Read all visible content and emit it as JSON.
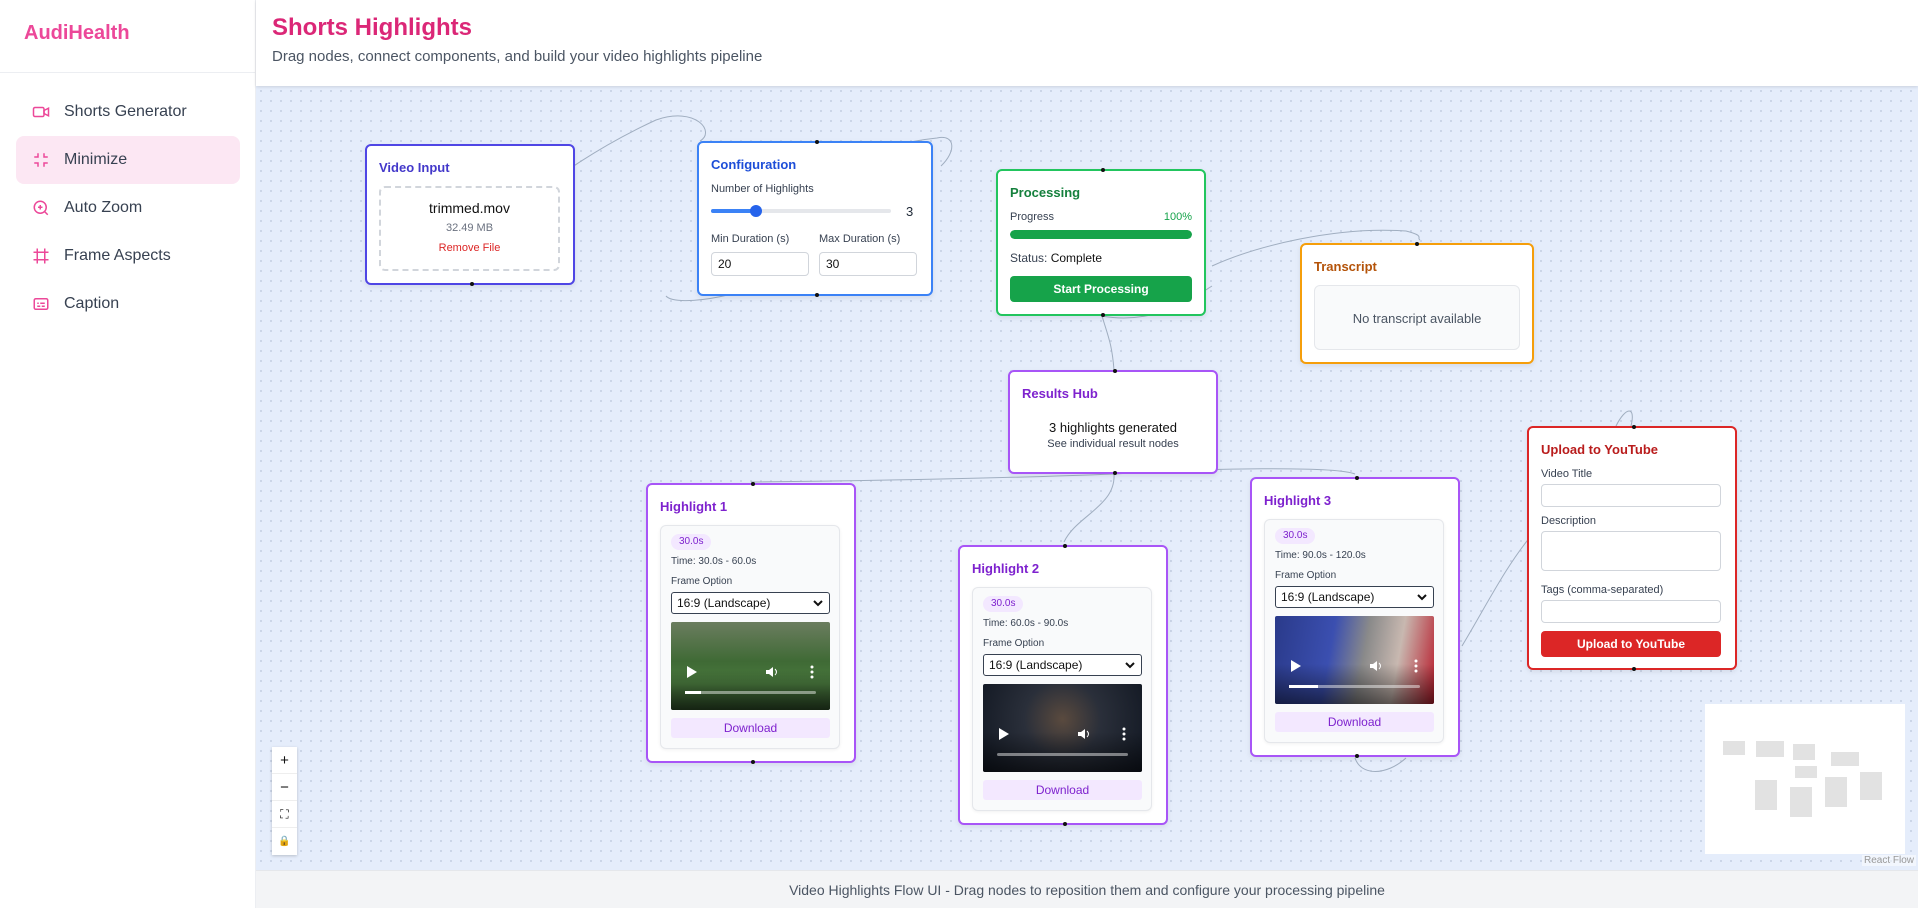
{
  "sidebar": {
    "brand": "AudiHealth",
    "items": [
      {
        "label": "Shorts Generator",
        "icon": "video-camera-icon"
      },
      {
        "label": "Minimize",
        "icon": "minimize-icon"
      },
      {
        "label": "Auto Zoom",
        "icon": "zoom-in-icon"
      },
      {
        "label": "Frame Aspects",
        "icon": "hash-frame-icon"
      },
      {
        "label": "Caption",
        "icon": "caption-icon"
      }
    ],
    "active": "Minimize"
  },
  "header": {
    "title": "Shorts Highlights",
    "subtitle": "Drag nodes, connect components, and build your video highlights pipeline"
  },
  "video_input": {
    "title": "Video Input",
    "file_name": "trimmed.mov",
    "file_size": "32.49 MB",
    "remove_label": "Remove File"
  },
  "configuration": {
    "title": "Configuration",
    "highlights_label": "Number of Highlights",
    "highlights_value": "3",
    "slider_fraction": 0.25,
    "min_label": "Min Duration (s)",
    "min_value": "20",
    "max_label": "Max Duration (s)",
    "max_value": "30"
  },
  "processing": {
    "title": "Processing",
    "progress_label": "Progress",
    "progress_text": "100%",
    "progress_fraction": 1.0,
    "status_label": "Status:",
    "status_value": "Complete",
    "button_label": "Start Processing"
  },
  "transcript": {
    "title": "Transcript",
    "empty_text": "No transcript available"
  },
  "results_hub": {
    "title": "Results Hub",
    "count_text": "3 highlights generated",
    "hint_text": "See individual result nodes"
  },
  "highlights": [
    {
      "title": "Highlight 1",
      "duration": "30.0s",
      "time": "Time: 30.0s - 60.0s",
      "frame_label": "Frame Option",
      "frame_value": "16:9 (Landscape)",
      "download_label": "Download"
    },
    {
      "title": "Highlight 2",
      "duration": "30.0s",
      "time": "Time: 60.0s - 90.0s",
      "frame_label": "Frame Option",
      "frame_value": "16:9 (Landscape)",
      "download_label": "Download"
    },
    {
      "title": "Highlight 3",
      "duration": "30.0s",
      "time": "Time: 90.0s - 120.0s",
      "frame_label": "Frame Option",
      "frame_value": "16:9 (Landscape)",
      "download_label": "Download"
    }
  ],
  "youtube": {
    "title": "Upload to YouTube",
    "video_title_label": "Video Title",
    "description_label": "Description",
    "tags_label": "Tags (comma-separated)",
    "button_label": "Upload to YouTube"
  },
  "controls": {
    "zoom_in": "+",
    "zoom_out": "−",
    "fit": "⛶",
    "lock": "🔒"
  },
  "attribution": "React Flow",
  "footer": "Video Highlights Flow UI - Drag nodes to reposition them and configure your processing pipeline",
  "colors": {
    "brand": "#ec4899",
    "video_input": "#4f46e5",
    "configuration": "#3b82f6",
    "processing": "#22c55e",
    "transcript": "#f59e0b",
    "results": "#a855f7",
    "youtube": "#dc2626"
  }
}
